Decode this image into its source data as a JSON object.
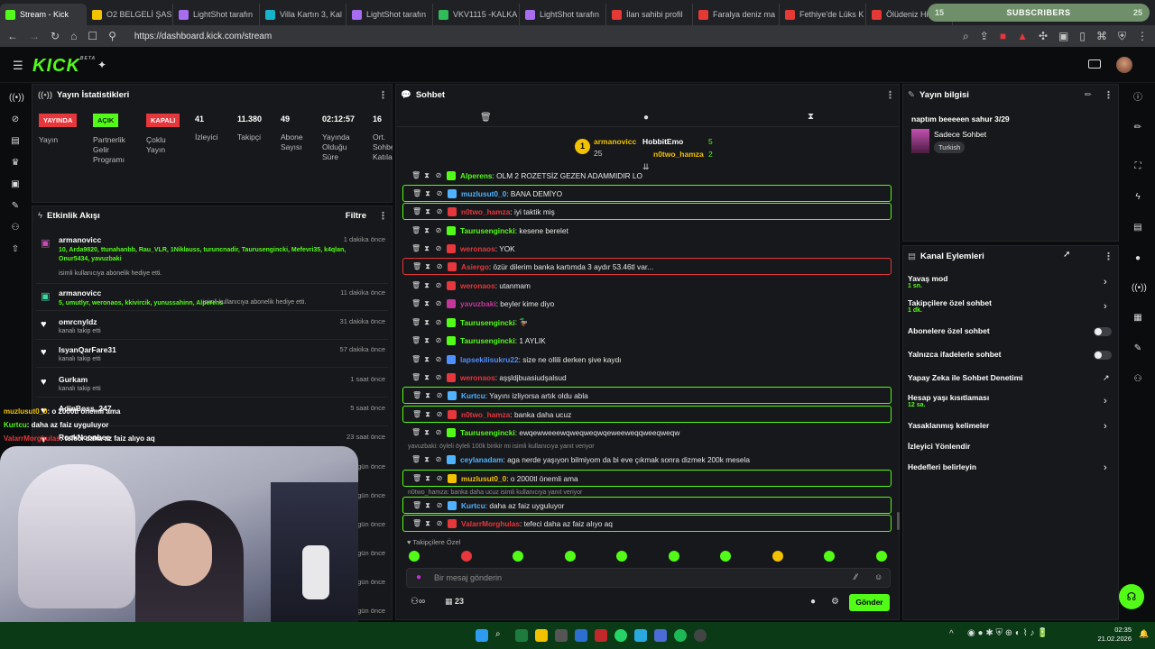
{
  "browser": {
    "tabs": [
      {
        "label": "Stream - Kick",
        "color": "#53fc18",
        "active": true
      },
      {
        "label": "O2 BELGELİ ŞAS",
        "color": "#f2c200"
      },
      {
        "label": "LightShot tarafın",
        "color": "#a86cf0"
      },
      {
        "label": "Villa Kartın 3, Kal",
        "color": "#17b3c8"
      },
      {
        "label": "LightShot tarafın",
        "color": "#a86cf0"
      },
      {
        "label": "VKV1115 -KALKA",
        "color": "#2ebd59"
      },
      {
        "label": "LightShot tarafın",
        "color": "#a86cf0"
      },
      {
        "label": "İlan sahibi profil",
        "color": "#e53935"
      },
      {
        "label": "Faralya deniz ma",
        "color": "#e53935"
      },
      {
        "label": "Fethiye'de Lüks K",
        "color": "#e53935"
      },
      {
        "label": "Ölüdeniz Hisa",
        "color": "#e53935"
      }
    ],
    "url": "https://dashboard.kick.com/stream",
    "subscribers": {
      "count": "15",
      "label": "SUBSCRIBERS",
      "right": "25"
    }
  },
  "logo": "KICK",
  "logo_beta": "BETA",
  "stats": {
    "title": "Yayın İstatistikleri",
    "badges": [
      {
        "text": "YAYINDA",
        "label": "Yayın",
        "color": "#e5373c"
      },
      {
        "text": "AÇIK",
        "label": "Partnerlik Gelir Programı",
        "color": "#53fc18"
      },
      {
        "text": "KAPALI",
        "label": "Çoklu Yayın",
        "color": "#e5373c"
      }
    ],
    "values": [
      {
        "value": "41",
        "label": "İzleyici"
      },
      {
        "value": "11.380",
        "label": "Takipçi"
      },
      {
        "value": "49",
        "label": "Abone Sayısı"
      },
      {
        "value": "02:12:57",
        "label": "Yayında Olduğu Süre"
      },
      {
        "value": "16",
        "label": "Ort. Sohbet Katıla"
      }
    ]
  },
  "feed": {
    "title": "Etkinlik Akışı",
    "filter": "Filtre",
    "items": [
      {
        "name": "armanovicc",
        "time": "1 dakika önce",
        "detail": "10, Arda9820, ttunahanbb, Rau_VLR, 1Niklauss, turuncnadir, Taurusengincki, Mefevri35, k4qlan, Onur5434, yavuzbaki",
        "sub": "isimli kullanıcıya abonelik hediye etti.",
        "icon": "gift"
      },
      {
        "name": "armanovicc",
        "time": "11 dakika önce",
        "detail": "5, umutlyr, weronaos, kkivircik, yunussahinn, Alperens",
        "sub": "isimli kullanıcıya abonelik hediye etti.",
        "icon": "sub"
      },
      {
        "name": "omrcnyldz",
        "time": "31 dakika önce",
        "sub": "kanalı takip etti",
        "icon": "heart"
      },
      {
        "name": "IsyanQarFare31",
        "time": "57 dakika önce",
        "sub": "kanalı takip etti",
        "icon": "heart"
      },
      {
        "name": "Gurkam",
        "time": "1 saat önce",
        "sub": "kanalı takip etti",
        "icon": "heart"
      },
      {
        "name": "AdinBoss_247",
        "time": "5 saat önce",
        "sub": "",
        "icon": "heart"
      },
      {
        "name": "RockNoonbee",
        "time": "23 saat önce",
        "sub": "",
        "icon": "heart"
      }
    ],
    "extra_times": [
      "gün önce",
      "gün önce",
      "gün önce",
      "gün önce",
      "gün önce",
      "gün önce"
    ]
  },
  "overlay_chat": [
    {
      "user": "muzlusut0_0",
      "text": ": o 2000tl önemli ama",
      "color": "#f2c200"
    },
    {
      "user": "Kurtcu",
      "text": ": daha az faiz uyguluyor",
      "color": "#53fc18"
    },
    {
      "user": "ValarrMorghulas",
      "text": ": tefeci daha az faiz alıyo aq",
      "color": "#e5373c"
    }
  ],
  "chat": {
    "title": "Sohbet",
    "pinned": {
      "first": {
        "name": "armanovicc",
        "count": "25",
        "color": "#f2c200"
      },
      "second": {
        "name": "HobbitEmo",
        "count": "5",
        "color": "#ffffff"
      },
      "third": {
        "name": "n0two_hamza",
        "count": "2",
        "color": "#f2c200"
      }
    },
    "messages": [
      {
        "user": "Alperens",
        "text": ": OLM 2 ROZETSİZ GEZEN ADAMMIDIR LO",
        "color": "#53fc18",
        "style": ""
      },
      {
        "user": "muzlusut0_0",
        "text": ": BANA DEMİYO",
        "color": "#4fb3ff",
        "style": "hl"
      },
      {
        "user": "n0two_hamza",
        "text": ": iyi taktik miş",
        "color": "#e5373c",
        "style": "hl"
      },
      {
        "user": "Taurusengincki",
        "text": ": kesene berelet",
        "color": "#53fc18",
        "style": ""
      },
      {
        "user": "weronaos",
        "text": ": YOK",
        "color": "#e5373c",
        "style": ""
      },
      {
        "user": "Asiergo",
        "text": ": özür dilerim banka kartımda 3 aydır 53.46tl var...",
        "color": "#e5373c",
        "style": "red"
      },
      {
        "user": "weronaos",
        "text": ": utanmam",
        "color": "#e5373c",
        "style": ""
      },
      {
        "user": "yavuzbaki",
        "text": ": beyler kime diyo",
        "color": "#c4379a",
        "style": ""
      },
      {
        "user": "Taurusengincki",
        "text": ": 🦆",
        "color": "#53fc18",
        "style": ""
      },
      {
        "user": "Taurusengincki",
        "text": ": 1 AYLIK",
        "color": "#53fc18",
        "style": ""
      },
      {
        "user": "lapsekilisukru22",
        "text": ": size ne ollili derken şive kaydı",
        "color": "#4f8fff",
        "style": ""
      },
      {
        "user": "weronaos",
        "text": ": aşşldjbuasiudşalsud",
        "color": "#e5373c",
        "style": ""
      },
      {
        "user": "Kurtcu",
        "text": ": Yayını izliyorsa artık oldu abla",
        "color": "#4fb3ff",
        "style": "hl"
      },
      {
        "user": "n0two_hamza",
        "text": ": banka daha ucuz",
        "color": "#e5373c",
        "style": "hl"
      },
      {
        "user": "Taurusengincki",
        "text": ": ewqewweeewqweqweqwqeweeweqqweeqweqw",
        "color": "#53fc18",
        "style": ""
      },
      {
        "user": "ceylanadam",
        "text": ": aga nerde yaşıyon bilmiyom da bi eve çıkmak sonra dizmek 200k mesela",
        "color": "#4fb3ff",
        "style": ""
      },
      {
        "user": "muzlusut0_0",
        "text": ": o 2000tl önemli ama",
        "color": "#f2c200",
        "style": "hl"
      },
      {
        "user": "Kurtcu",
        "text": ": daha az faiz uyguluyor",
        "color": "#4fb3ff",
        "style": "hl"
      },
      {
        "user": "ValarrMorghulas",
        "text": ": tefeci daha az faiz alıyo aq",
        "color": "#e5373c",
        "style": "hl"
      }
    ],
    "replies": [
      "yavuzbaki: öyleli öyleli 100k birikir mi isimli kullanıcıya yanıt veriyor",
      "n0two_hamza: banka daha ucuz isimli kullanıcıya yanıt veriyor"
    ],
    "followers_only": "Takipçilere Özel",
    "placeholder": "Bir mesaj gönderin",
    "viewer_count": "23",
    "send_label": "Gönder"
  },
  "stream_info": {
    "title": "Yayın bilgisi",
    "stream_title": "naptım beeeeen sahur 3/29",
    "category": "Sadece Sohbet",
    "language": "Turkish"
  },
  "channel_actions": {
    "title": "Kanal Eylemleri",
    "items": [
      {
        "label": "Yavaş mod",
        "sub": "1 sn.",
        "control": "chevron"
      },
      {
        "label": "Takipçilere özel sohbet",
        "sub": "1 dk.",
        "control": "chevron"
      },
      {
        "label": "Abonelere özel sohbet",
        "sub": "",
        "control": "toggle"
      },
      {
        "label": "Yalnızca ifadelerle sohbet",
        "sub": "",
        "control": "toggle"
      },
      {
        "label": "Yapay Zeka ile Sohbet Denetimi",
        "sub": "",
        "control": "external"
      },
      {
        "label": "Hesap yaşı kısıtlaması",
        "sub": "12 sa.",
        "control": "chevron"
      },
      {
        "label": "Yasaklanmış kelimeler",
        "sub": "",
        "control": "chevron"
      },
      {
        "label": "İzleyici Yönlendir",
        "sub": "",
        "control": "none"
      },
      {
        "label": "Hedefleri belirleyin",
        "sub": "",
        "control": "chevron"
      }
    ]
  },
  "taskbar": {
    "time": "02:35",
    "date": "21.02.2026"
  }
}
